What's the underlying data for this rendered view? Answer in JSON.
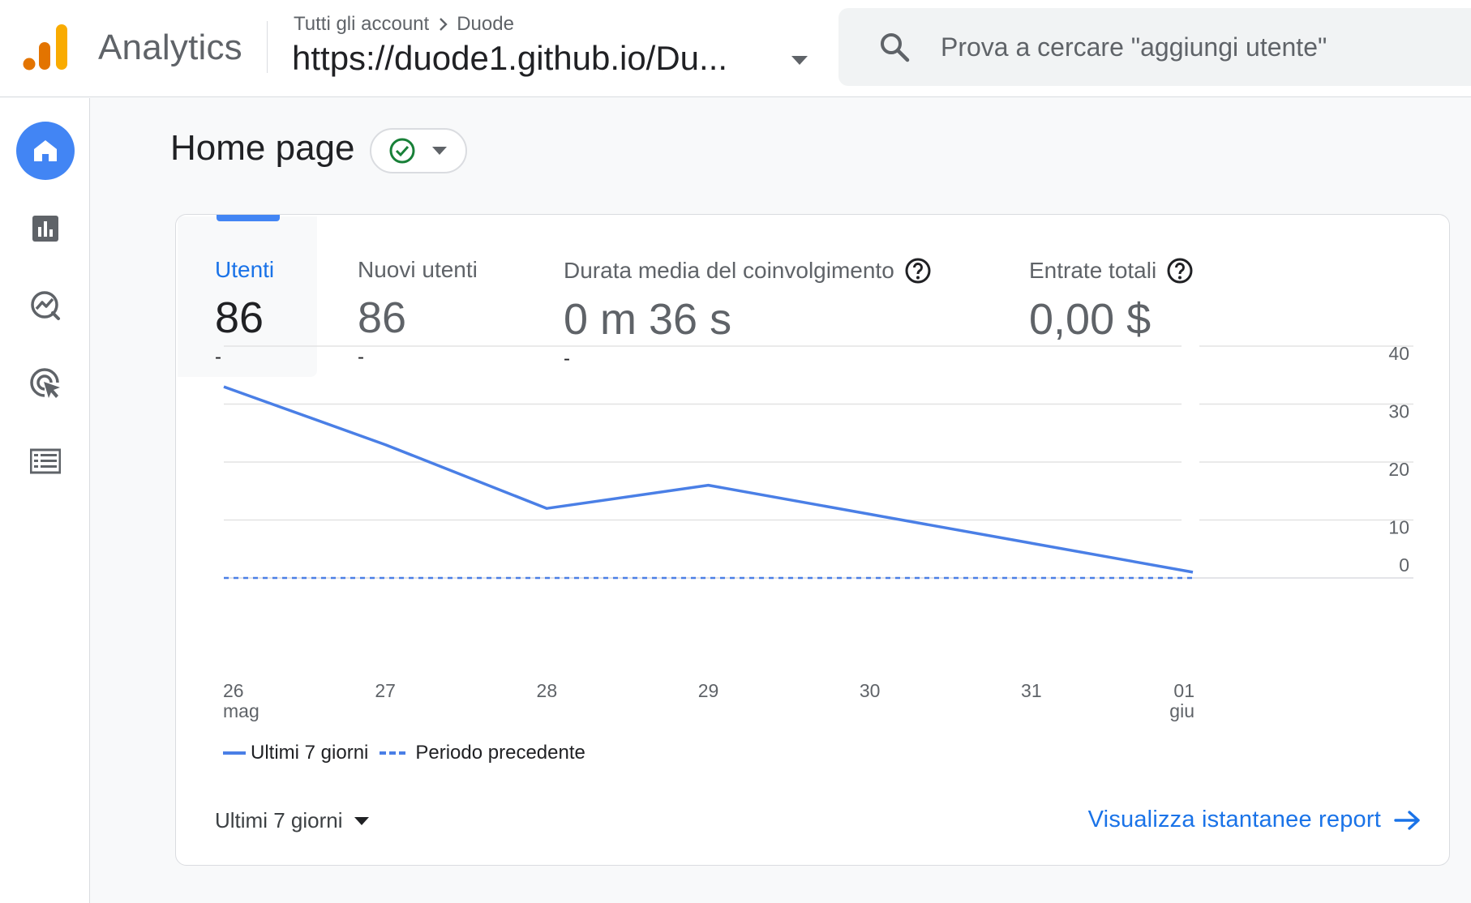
{
  "header": {
    "app_name": "Analytics",
    "breadcrumb": {
      "root": "Tutti gli account",
      "account": "Duode"
    },
    "property_name": "https://duode1.github.io/Du...",
    "search_placeholder": "Prova a cercare \"aggiungi utente\""
  },
  "sidenav": {
    "items": [
      {
        "icon": "home-icon",
        "active": true
      },
      {
        "icon": "bar-chart-icon",
        "active": false
      },
      {
        "icon": "explore-icon",
        "active": false
      },
      {
        "icon": "advertising-icon",
        "active": false
      },
      {
        "icon": "list-icon",
        "active": false
      }
    ]
  },
  "page": {
    "title": "Home page"
  },
  "metrics": [
    {
      "label": "Utenti",
      "value": "86",
      "delta": "-"
    },
    {
      "label": "Nuovi utenti",
      "value": "86",
      "delta": "-"
    },
    {
      "label": "Durata media del coinvolgimento",
      "value": "0 m 36 s",
      "delta": "-"
    },
    {
      "label": "Entrate totali",
      "value": "0,00 $",
      "delta": ""
    }
  ],
  "chart_data": {
    "type": "line",
    "x": [
      "26 mag",
      "27",
      "28",
      "29",
      "30",
      "31",
      "01 giu"
    ],
    "x_ticks": [
      {
        "main": "26",
        "sub": "mag"
      },
      {
        "main": "27",
        "sub": ""
      },
      {
        "main": "28",
        "sub": ""
      },
      {
        "main": "29",
        "sub": ""
      },
      {
        "main": "30",
        "sub": ""
      },
      {
        "main": "31",
        "sub": ""
      },
      {
        "main": "01",
        "sub": "giu"
      }
    ],
    "y_ticks": [
      "40",
      "30",
      "20",
      "10",
      "0"
    ],
    "ylim": [
      0,
      40
    ],
    "grid": true,
    "series": [
      {
        "name": "Ultimi 7 giorni",
        "style": "solid",
        "values": [
          33,
          23,
          12,
          16,
          11,
          6,
          1
        ]
      },
      {
        "name": "Periodo precedente",
        "style": "dashed",
        "values": [
          0,
          0,
          0,
          0,
          0,
          0,
          0
        ]
      }
    ],
    "color": "#4a7fe6"
  },
  "footer": {
    "range_label": "Ultimi 7 giorni",
    "report_link": "Visualizza istantanee report"
  }
}
